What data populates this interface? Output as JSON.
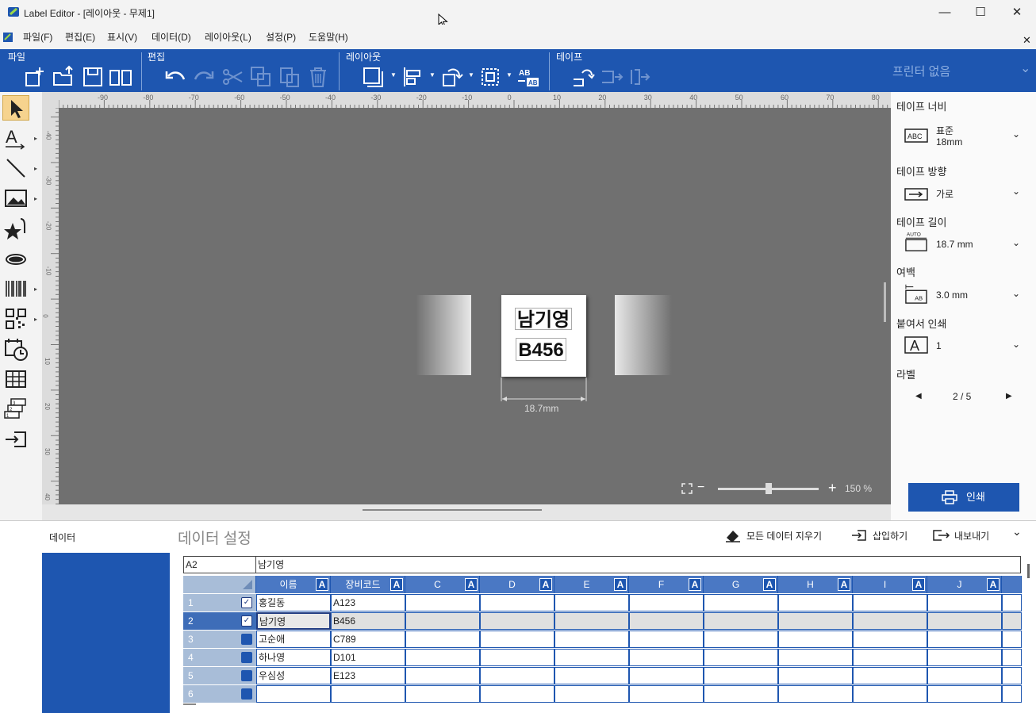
{
  "window": {
    "title": "Label Editor - [레이아웃  - 무제1]",
    "minimize": "—",
    "maximize": "☐",
    "close": "✕",
    "doc_close": "✕"
  },
  "menu": [
    "파일(F)",
    "편집(E)",
    "표시(V)",
    "데이터(D)",
    "레이아웃(L)",
    "설정(P)",
    "도움말(H)"
  ],
  "ribbon": {
    "groups": [
      "파일",
      "편집",
      "레이아웃",
      "테이프"
    ],
    "printer": "프린터 없음",
    "printer_chevron": "⌄"
  },
  "left_tools": [
    "select-tool",
    "text-tool",
    "line-tool",
    "image-tool",
    "clipart-tool",
    "shape-tool",
    "barcode-tool",
    "qrcode-tool",
    "datetime-tool",
    "table-tool",
    "serial-tool",
    "insert-tool"
  ],
  "canvas": {
    "label_line1": "남기영",
    "label_line2": "B456",
    "dimension": "18.7mm",
    "zoom": "150 %",
    "zoom_level": 0.5,
    "hruler_labels": [
      "-90",
      "-80",
      "-70",
      "-60",
      "-50",
      "-40",
      "-30",
      "-20",
      "-10",
      "0",
      "10",
      "20",
      "30",
      "40",
      "50",
      "60",
      "70",
      "80"
    ],
    "vruler_labels": [
      "-40",
      "-30",
      "-20",
      "-10",
      "0",
      "10",
      "20",
      "30",
      "40"
    ]
  },
  "right_panel": {
    "tape_width_label": "테이프 너비",
    "tape_width_value1": "표준",
    "tape_width_value2": "18mm",
    "tape_width_icon_text": "ABC",
    "tape_dir_label": "테이프 방향",
    "tape_dir_value": "가로",
    "tape_len_label": "테이프 길이",
    "tape_len_value": "18.7 mm",
    "tape_len_icon_text": "AUTO",
    "margin_label": "여백",
    "margin_value": "3.0 mm",
    "margin_icon_text": "AB",
    "chain_label": "붙여서 인쇄",
    "chain_value": "1",
    "chain_icon_text": "A",
    "label_label": "라벨",
    "label_page": "2 / 5",
    "prev": "◀",
    "next": "▶",
    "chev": "⌄",
    "print_button": "인쇄"
  },
  "data_panel": {
    "side_label": "데이터",
    "title": "데이터 설정",
    "clear_all": "모든 데이터 지우기",
    "insert": "삽입하기",
    "export": "내보내기",
    "expand": "⌄",
    "cell_ref": "A2",
    "cell_value": "남기영",
    "columns": [
      "이름",
      "장비코드",
      "C",
      "D",
      "E",
      "F",
      "G",
      "H",
      "I",
      "J"
    ],
    "col_badge": "A",
    "rows": [
      {
        "num": "1",
        "checked": true,
        "name": "홍길동",
        "code": "A123"
      },
      {
        "num": "2",
        "checked": true,
        "name": "남기영",
        "code": "B456"
      },
      {
        "num": "3",
        "checked": false,
        "name": "고순애",
        "code": "C789"
      },
      {
        "num": "4",
        "checked": false,
        "name": "하나영",
        "code": "D101"
      },
      {
        "num": "5",
        "checked": false,
        "name": "우심성",
        "code": "E123"
      },
      {
        "num": "6",
        "checked": false,
        "name": "",
        "code": ""
      }
    ],
    "check_mark": "✓"
  }
}
